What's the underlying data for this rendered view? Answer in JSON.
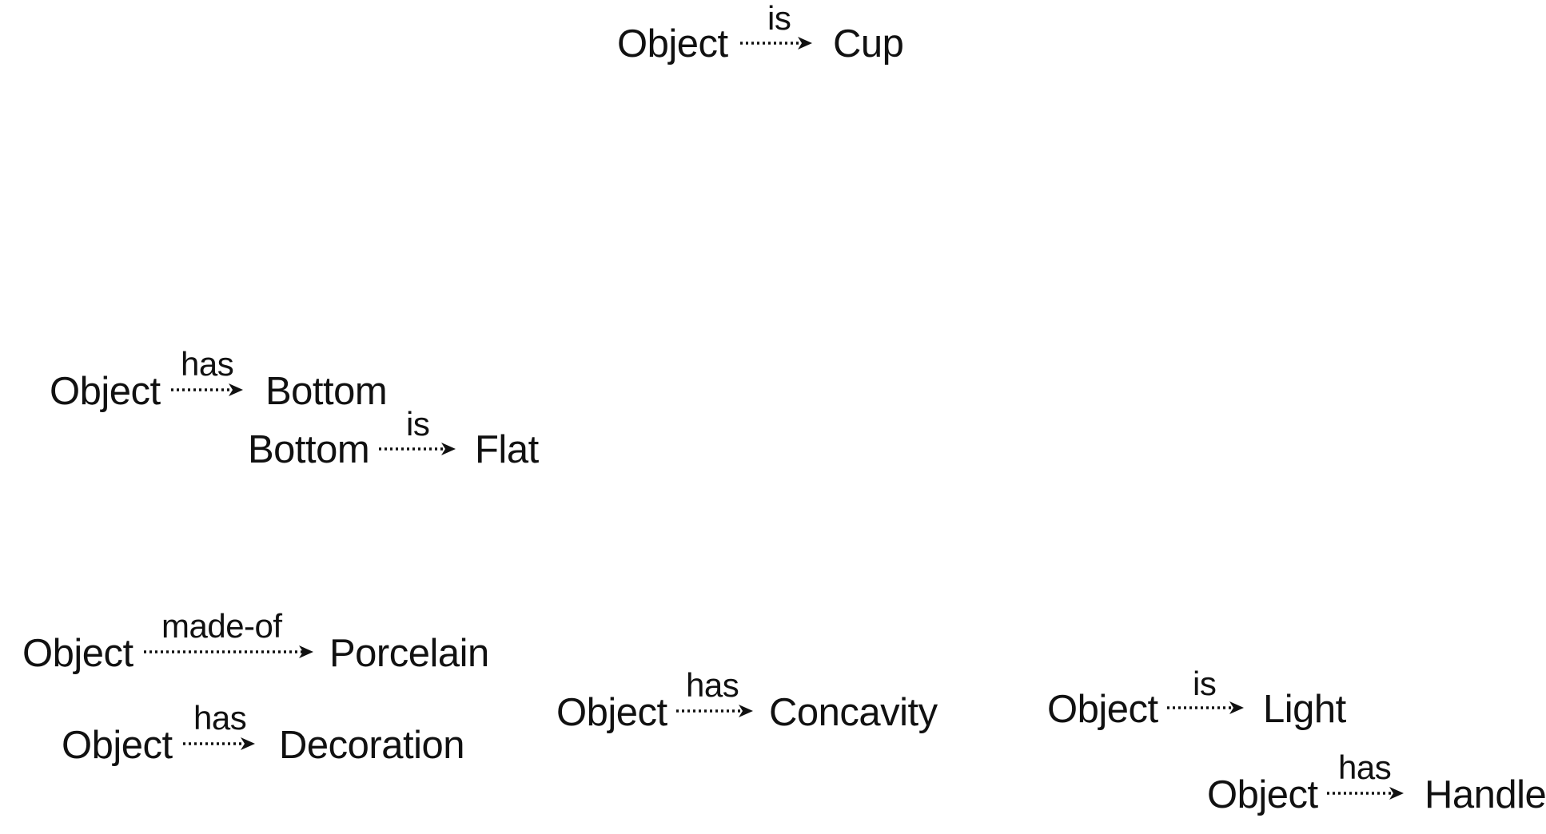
{
  "triples": [
    {
      "subject": "Object",
      "relation": "is",
      "object": "Cup"
    },
    {
      "subject": "Object",
      "relation": "has",
      "object": "Bottom"
    },
    {
      "subject": "Bottom",
      "relation": "is",
      "object": "Flat"
    },
    {
      "subject": "Object",
      "relation": "made-of",
      "object": "Porcelain"
    },
    {
      "subject": "Object",
      "relation": "has",
      "object": "Decoration"
    },
    {
      "subject": "Object",
      "relation": "has",
      "object": "Concavity"
    },
    {
      "subject": "Object",
      "relation": "is",
      "object": "Light"
    },
    {
      "subject": "Object",
      "relation": "has",
      "object": "Handle"
    }
  ],
  "colors": {
    "text": "#111111",
    "arrow": "#111111",
    "background": "#ffffff"
  }
}
